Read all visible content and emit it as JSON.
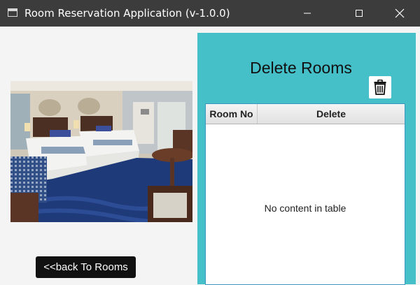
{
  "window": {
    "title": "Room Reservation Application (v-1.0.0)",
    "controls": [
      "minimize-icon",
      "maximize-icon",
      "close-icon"
    ]
  },
  "left": {
    "photo": "hotel-room-photo",
    "back_label": "<<back To Rooms"
  },
  "panel": {
    "title": "Delete Rooms",
    "delete_icon": "trash-icon",
    "table": {
      "columns": [
        "Room No",
        "Delete"
      ],
      "rows": [],
      "empty_message": "No content in table"
    }
  },
  "colors": {
    "panel_bg": "#45bfc8",
    "titlebar_bg": "#3c3c3c",
    "button_bg": "#111111",
    "table_border": "#3b97bd"
  }
}
